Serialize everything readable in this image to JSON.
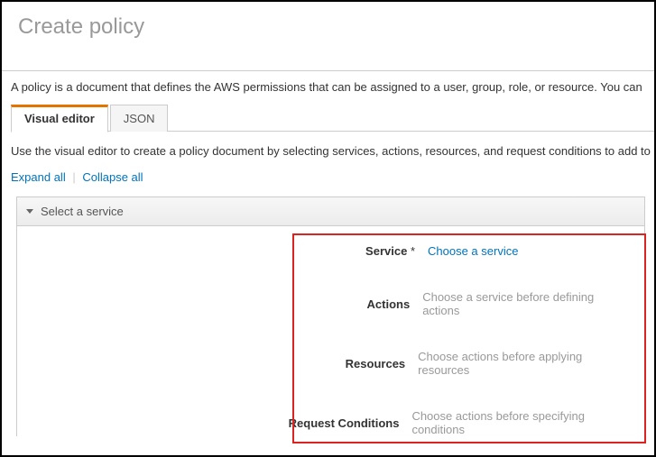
{
  "header": {
    "title": "Create policy"
  },
  "intro": "A policy is a document that defines the AWS permissions that can be assigned to a user, group, role, or resource. You can",
  "tabs": {
    "visual": "Visual editor",
    "json": "JSON"
  },
  "tabDescription": "Use the visual editor to create a policy document by selecting services, actions, resources, and request conditions to add to",
  "links": {
    "expand": "Expand all",
    "collapse": "Collapse all"
  },
  "accordion": {
    "title": "Select a service"
  },
  "form": {
    "service": {
      "label": "Service",
      "required": "*",
      "value": "Choose a service"
    },
    "actions": {
      "label": "Actions",
      "value": "Choose a service before defining actions"
    },
    "resources": {
      "label": "Resources",
      "value": "Choose actions before applying resources"
    },
    "conditions": {
      "label": "Request Conditions",
      "value": "Choose actions before specifying conditions"
    }
  }
}
